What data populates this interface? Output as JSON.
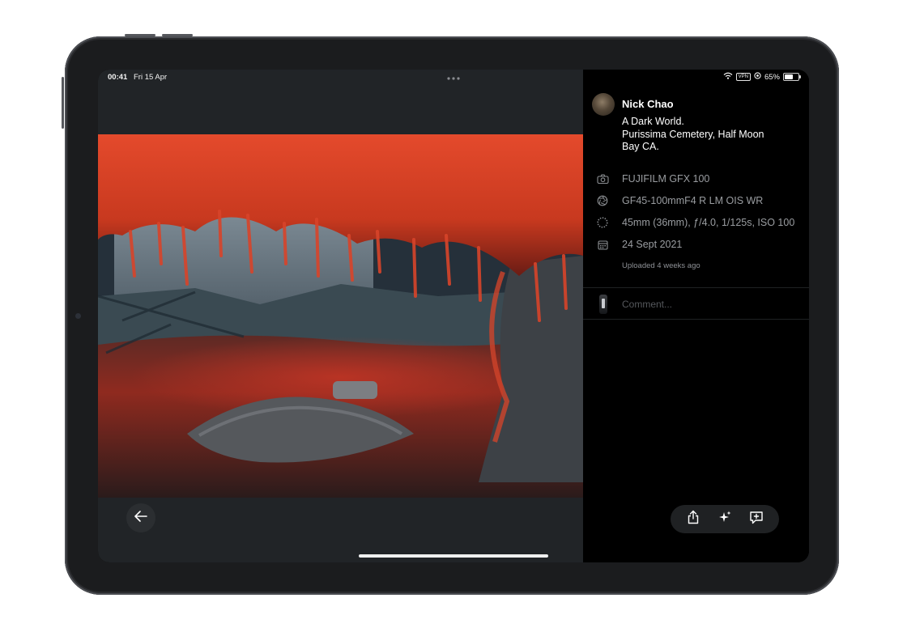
{
  "status_bar": {
    "time": "00:41",
    "date": "Fri 15 Apr",
    "vpn_label": "VPN",
    "battery": "65%",
    "battery_level": 0.65
  },
  "photo_info": {
    "author": "Nick Chao",
    "description_lines": [
      "A Dark World.",
      "Purissima Cemetery, Half Moon",
      "Bay CA."
    ],
    "camera": "FUJIFILM GFX 100",
    "lens": "GF45-100mmF4 R LM OIS WR",
    "exposure": "45mm (36mm), ƒ/4.0, 1/125s, ISO 100",
    "date_taken": "24 Sept 2021",
    "uploaded": "Uploaded 4 weeks ago"
  },
  "comment": {
    "placeholder": "Comment..."
  },
  "icons": {
    "back": "arrow-left-icon",
    "camera": "camera-icon",
    "lens": "aperture-icon",
    "exposure": "exposure-dial-icon",
    "date": "calendar-icon",
    "share": "share-icon",
    "magic": "sparkles-icon",
    "add_comment": "add-comment-icon"
  },
  "colors": {
    "screen_bg": "#000000",
    "viewer_bg": "#212427",
    "muted_text": "#9a9da1",
    "accent_foliage": "#d8442a"
  }
}
